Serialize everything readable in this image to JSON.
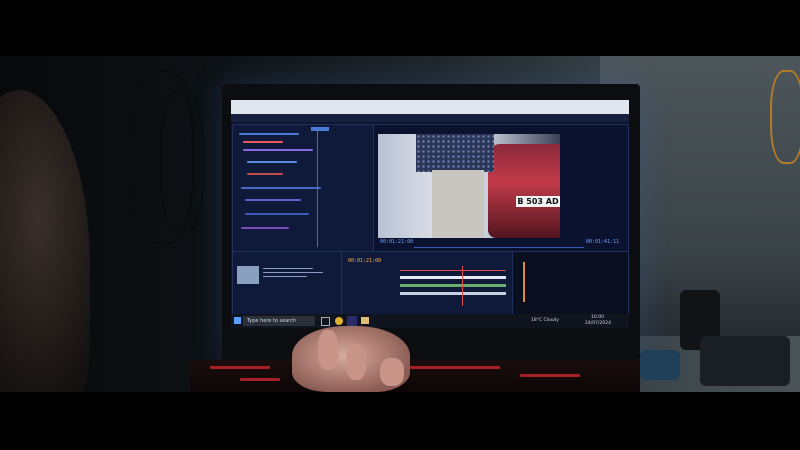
{
  "scene": {
    "description_visible_text": true,
    "video_plate": "B 503 AD",
    "program_timecode_left": "00:01:21:00",
    "program_timecode_right": "00:01:41:11",
    "sequence_timecode": "00:01:21:00",
    "taskbar": {
      "search_placeholder": "Type here to search",
      "weather": "18°C Cloudy",
      "time": "10:00",
      "date": "24/07/2024"
    },
    "colors": {
      "screen_bg": "#0d1530",
      "accent_blue": "#6fa8ff",
      "keyboard_glow": "#c0242a",
      "car_red": "#c23a4a"
    },
    "icons": [
      "windows-start-icon",
      "task-view-icon",
      "chrome-icon",
      "premiere-icon",
      "explorer-icon"
    ]
  }
}
